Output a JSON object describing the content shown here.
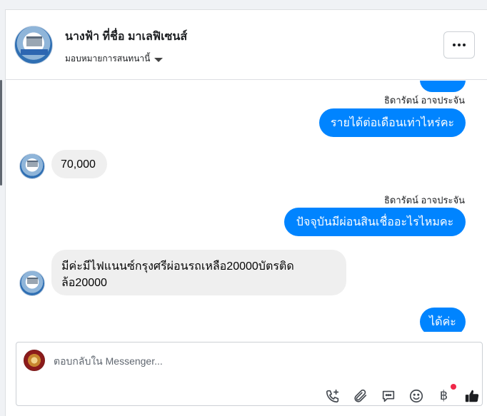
{
  "header": {
    "page_name": "นางฟ้า ที่ชื่อ มาเลฟิเซนส์",
    "assign_label": "มอบหมายการสนทนานี้"
  },
  "messages": [
    {
      "direction": "out",
      "text": ""
    },
    {
      "direction": "out",
      "sender": "ธิดารัตน์ อาจประจัน",
      "text": "รายได้ต่อเดือนเท่าไหร่คะ"
    },
    {
      "direction": "in",
      "text": "70,000"
    },
    {
      "direction": "out",
      "sender": "ธิดารัตน์ อาจประจัน",
      "text": "ปัจจุบันมีผ่อนสินเชื่ออะไรไหมคะ"
    },
    {
      "direction": "in",
      "text_line1": "มีค่ะมีไฟแนนซ์กรุงศรีผ่อนรถเหลือ20000บัตรติด",
      "text_line2": "ล้อ20000"
    },
    {
      "direction": "out",
      "text": "ได้ค่ะ"
    }
  ],
  "composer": {
    "placeholder": "ตอบกลับใน Messenger...",
    "baht_symbol": "฿",
    "tools": [
      "add-call-icon",
      "attachment-icon",
      "saved-replies-icon",
      "emoji-icon",
      "payment-icon",
      "like-icon"
    ]
  },
  "colors": {
    "outgoing": "#0084ff",
    "incoming": "#efefef",
    "notification_dot": "#f02849"
  }
}
